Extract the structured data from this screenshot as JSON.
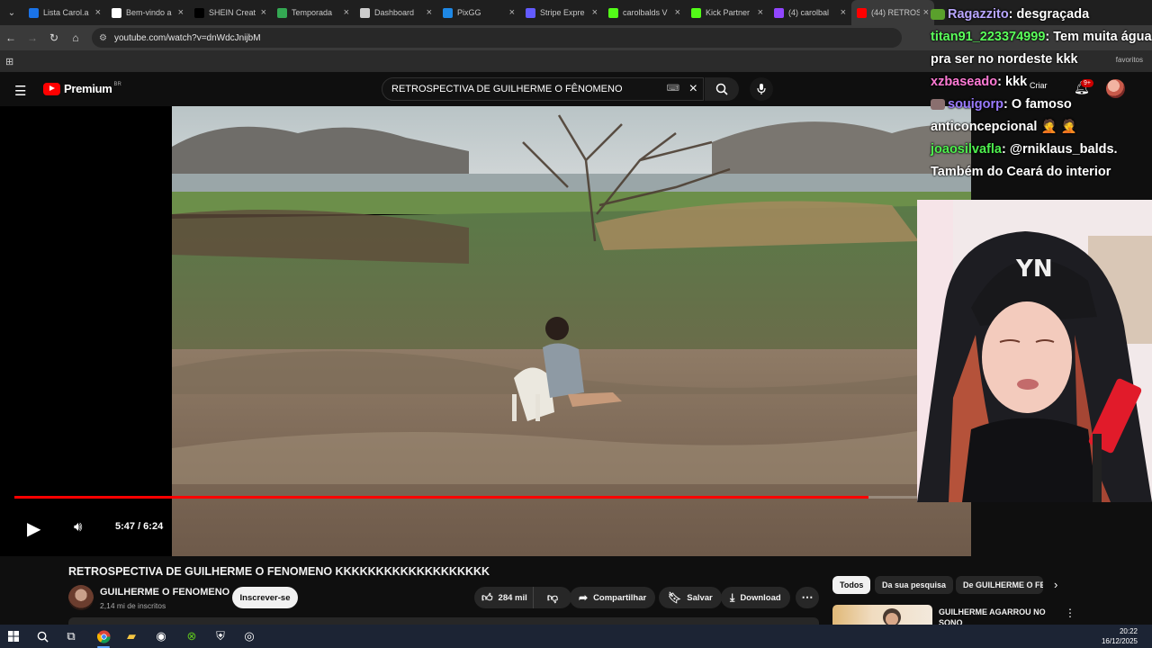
{
  "browser": {
    "tabs": [
      {
        "label": "Lista Carol.a",
        "icon_color": "#1a73e8",
        "active": false
      },
      {
        "label": "Bem-vindo a",
        "icon_color": "#ffffff",
        "active": false
      },
      {
        "label": "SHEIN Creat",
        "icon_color": "#000000",
        "active": false
      },
      {
        "label": "Temporada",
        "icon_color": "#34a853",
        "active": false
      },
      {
        "label": "Dashboard",
        "icon_color": "#cccccc",
        "active": false
      },
      {
        "label": "PixGG",
        "icon_color": "#1e88e5",
        "active": false
      },
      {
        "label": "Stripe Expre",
        "icon_color": "#635bff",
        "active": false
      },
      {
        "label": "carolbalds V",
        "icon_color": "#53fc18",
        "active": false
      },
      {
        "label": "Kick Partner",
        "icon_color": "#53fc18",
        "active": false
      },
      {
        "label": "(4) carolbal",
        "icon_color": "#9146ff",
        "active": false
      },
      {
        "label": "(44) RETROS",
        "icon_color": "#ff0000",
        "active": true
      }
    ],
    "url": "youtube.com/watch?v=dnWdcJnijbM",
    "bookmarks_folder": "favoritos"
  },
  "youtube": {
    "brand": "Premium",
    "region": "BR",
    "search_query": "RETROSPECTIVA DE GUILHERME O FÊNOMENO",
    "create_label": "Criar",
    "notification_count": "9+"
  },
  "player": {
    "time_display": "5:47 / 6:24",
    "progress_fraction": 0.906
  },
  "video": {
    "title": "RETROSPECTIVA DE GUILHERME O FENOMENO KKKKKKKKKKKKKKKKKKK",
    "channel": "GUILHERME O FENOMENO",
    "subscribers": "2,14 mi de inscritos",
    "subscribe_label": "Inscrever-se",
    "likes": "284 mil",
    "share_label": "Compartilhar",
    "save_label": "Salvar",
    "download_label": "Download"
  },
  "chips": [
    "Todos",
    "Da sua pesquisa",
    "De GUILHERME O FE"
  ],
  "recommendation": {
    "title": "GUILHERME AGARROU NO SONO KKKKKKKKKKKKKKKKKK"
  },
  "chat": [
    {
      "user": "Ragazzito",
      "text": ": desgraçada",
      "color": "#b9a6ff",
      "badge": "#5aa02c"
    },
    {
      "user": "titan91_223374999",
      "text": ": Tem muita água pra ser no nordeste kkk",
      "color": "#5bff5b",
      "badge": ""
    },
    {
      "user": "xzbaseado",
      "text": ": kkk",
      "color": "#ff7bd5",
      "badge": ""
    },
    {
      "user": "souigorp",
      "text": ": O famoso anticoncepcional 🤦 🤦",
      "color": "#9a7bff",
      "badge": "#8a6f6f"
    },
    {
      "user": "joaosilvafla",
      "text": ": @rniklaus_balds. Também do Ceará do interior",
      "color": "#4ef04e",
      "badge": ""
    }
  ],
  "taskbar": {
    "time": "20:22",
    "date": "16/12/2025"
  },
  "colors": {
    "youtube_red": "#ff0000",
    "background": "#0f0f0f"
  }
}
